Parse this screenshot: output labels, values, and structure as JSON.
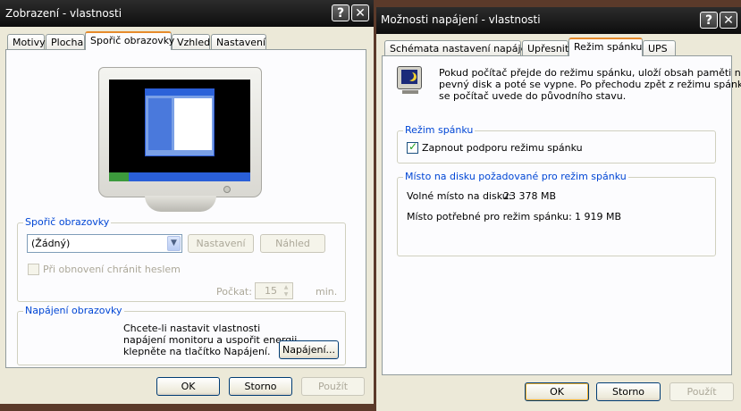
{
  "display_window": {
    "title": "Zobrazení - vlastnosti",
    "help_icon_label": "?",
    "close_icon_label": "✕",
    "tabs": [
      {
        "label": "Motivy"
      },
      {
        "label": "Plocha"
      },
      {
        "label": "Spořič obrazovky"
      },
      {
        "label": "Vzhled"
      },
      {
        "label": "Nastavení"
      }
    ],
    "active_tab": "Spořič obrazovky",
    "screensaver_group": {
      "label": "Spořič obrazovky",
      "selected_value": "(Žádný)",
      "settings_label": "Nastavení",
      "preview_label": "Náhled",
      "protect_checkbox_label": "Při obnovení chránit heslem",
      "wait_label": "Počkat:",
      "wait_value": "15",
      "minutes_label": "min."
    },
    "power_group": {
      "label": "Napájení obrazovky",
      "description_line1": "Chcete-li nastavit vlastnosti",
      "description_line2": "napájení monitoru a uspořit energii,",
      "description_line3": "klepněte na tlačítko Napájení.",
      "power_button_label": "Napájení..."
    },
    "buttons": {
      "ok": "OK",
      "cancel": "Storno",
      "apply": "Použít"
    }
  },
  "power_window": {
    "title": "Možnosti napájení - vlastnosti",
    "help_icon_label": "?",
    "close_icon_label": "✕",
    "tabs": [
      {
        "label": "Schémata nastavení napájení"
      },
      {
        "label": "Upřesnit"
      },
      {
        "label": "Režim spánku"
      },
      {
        "label": "UPS"
      }
    ],
    "active_tab": "Režim spánku",
    "intro_line1": "Pokud počítač přejde do režimu spánku, uloží obsah paměti na",
    "intro_line2": "pevný disk a poté se vypne. Po přechodu zpět z režimu spánku",
    "intro_line3": "se počítač uvede do původního stavu.",
    "hibernate_group": {
      "label": "Režim spánku",
      "checkbox_label": "Zapnout podporu režimu spánku",
      "checked": true
    },
    "disk_group": {
      "label": "Místo na disku požadované pro režim spánku",
      "free_label": "Volné místo na disku:",
      "free_value": "23 378 MB",
      "required_label": "Místo potřebné pro režim spánku:",
      "required_value": "1 919 MB"
    },
    "buttons": {
      "ok": "OK",
      "cancel": "Storno",
      "apply": "Použít"
    }
  },
  "colors": {
    "accent_tab": "#e68b2c",
    "group_label": "#0046d5",
    "titlebar": "#1a1a1a"
  }
}
